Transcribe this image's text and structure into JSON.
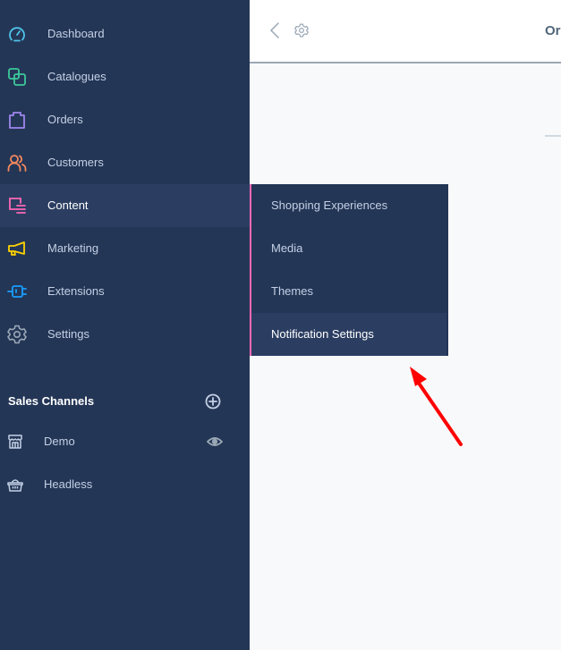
{
  "sidebar": {
    "items": [
      {
        "label": "Dashboard",
        "icon": "dashboard-icon",
        "color": "#4fc3e8"
      },
      {
        "label": "Catalogues",
        "icon": "catalogues-icon",
        "color": "#3cc99a"
      },
      {
        "label": "Orders",
        "icon": "orders-icon",
        "color": "#9f87ee"
      },
      {
        "label": "Customers",
        "icon": "customers-icon",
        "color": "#f5895d"
      },
      {
        "label": "Content",
        "icon": "content-icon",
        "color": "#ff68b4",
        "active": true
      },
      {
        "label": "Marketing",
        "icon": "marketing-icon",
        "color": "#ffd400"
      },
      {
        "label": "Extensions",
        "icon": "extensions-icon",
        "color": "#189eff"
      },
      {
        "label": "Settings",
        "icon": "settings-icon",
        "color": "#9aa8b5"
      }
    ],
    "sales_channels": {
      "title": "Sales Channels",
      "add_icon": "plus-circle-icon",
      "items": [
        {
          "label": "Demo",
          "icon": "storefront-icon",
          "has_eye": true
        },
        {
          "label": "Headless",
          "icon": "basket-icon",
          "has_eye": false
        }
      ]
    }
  },
  "topbar": {
    "back_icon": "chevron-left-icon",
    "settings_icon": "gear-icon",
    "title_fragment": "Or"
  },
  "flyout": {
    "accent": "#ff68b4",
    "items": [
      {
        "label": "Shopping Experiences"
      },
      {
        "label": "Media"
      },
      {
        "label": "Themes"
      },
      {
        "label": "Notification Settings",
        "active": true
      }
    ]
  },
  "annotation": {
    "type": "arrow",
    "color": "#ff0000",
    "points_to": "Notification Settings"
  }
}
